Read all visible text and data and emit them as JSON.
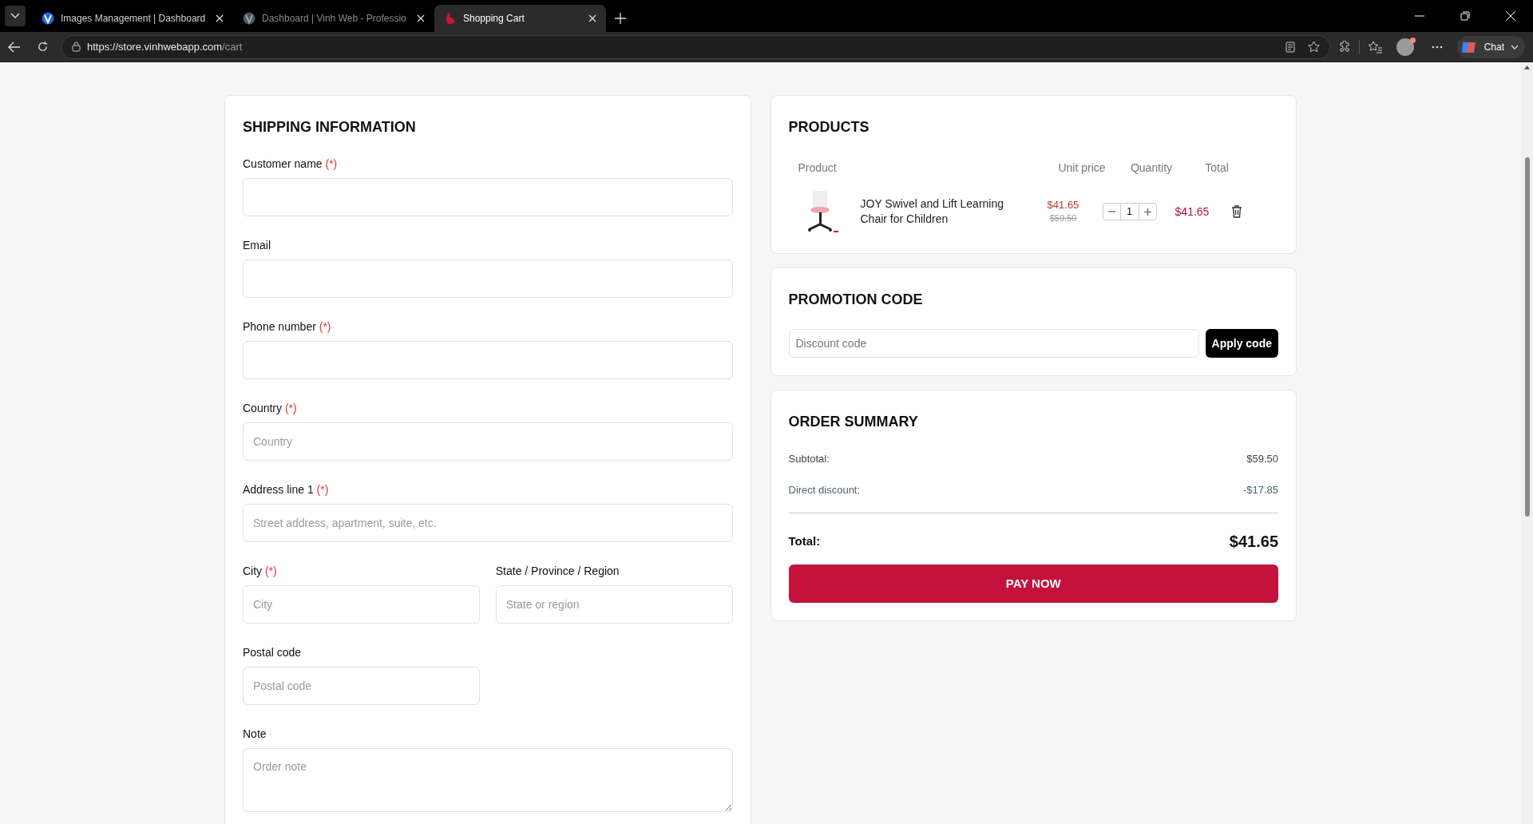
{
  "browser": {
    "tabs": [
      {
        "title": "Images Management | Dashboard",
        "selected": false
      },
      {
        "title": "Dashboard | Vinh Web - Professio",
        "selected": false
      },
      {
        "title": "Shopping Cart",
        "selected": true
      }
    ],
    "url_host": "https://store.vinhwebapp.com",
    "url_path": "/cart",
    "chat_label": "Chat"
  },
  "shipping": {
    "title": "SHIPPING INFORMATION",
    "rows": [
      {
        "fields": [
          {
            "label": "Customer name",
            "required_mark": "(*)",
            "kind": "input"
          }
        ]
      },
      {
        "fields": [
          {
            "label": "Email",
            "kind": "input"
          }
        ]
      },
      {
        "fields": [
          {
            "label": "Phone number",
            "required_mark": "(*)",
            "kind": "input"
          }
        ]
      },
      {
        "fields": [
          {
            "label": "Country",
            "required_mark": "(*)",
            "placeholder": "Country",
            "kind": "input"
          }
        ]
      },
      {
        "fields": [
          {
            "label": "Address line 1",
            "required_mark": "(*)",
            "placeholder": "Street address, apartment, suite, etc.",
            "kind": "input"
          }
        ]
      },
      {
        "fields": [
          {
            "label": "City",
            "required_mark": "(*)",
            "placeholder": "City",
            "kind": "input"
          },
          {
            "label": "State / Province / Region",
            "placeholder": "State or region",
            "kind": "input"
          }
        ]
      },
      {
        "fields": [
          {
            "label": "Postal code",
            "placeholder": "Postal code",
            "kind": "input"
          },
          {
            "kind": "empty"
          }
        ]
      },
      {
        "fields": [
          {
            "label": "Note",
            "placeholder": "Order note",
            "kind": "textarea"
          }
        ]
      }
    ]
  },
  "products": {
    "title": "PRODUCTS",
    "columns": [
      "Product",
      "Unit price",
      "Quantity",
      "Total"
    ],
    "rows": [
      {
        "name": "JOY Swivel and Lift Learning Chair for Children",
        "unit_price": "$41.65",
        "old_price": "$59.50",
        "quantity": "1",
        "total": "$41.65"
      }
    ]
  },
  "promotion": {
    "title": "PROMOTION CODE",
    "placeholder": "Discount code",
    "button": "Apply code"
  },
  "summary": {
    "title": "ORDER SUMMARY",
    "lines": [
      {
        "label": "Subtotal:",
        "value": "$59.50",
        "kind": "plain"
      },
      {
        "label": "Direct discount:",
        "value": "-$17.85",
        "kind": "discount"
      }
    ],
    "total_label": "Total:",
    "total_value": "$41.65",
    "button": "PAY NOW"
  }
}
